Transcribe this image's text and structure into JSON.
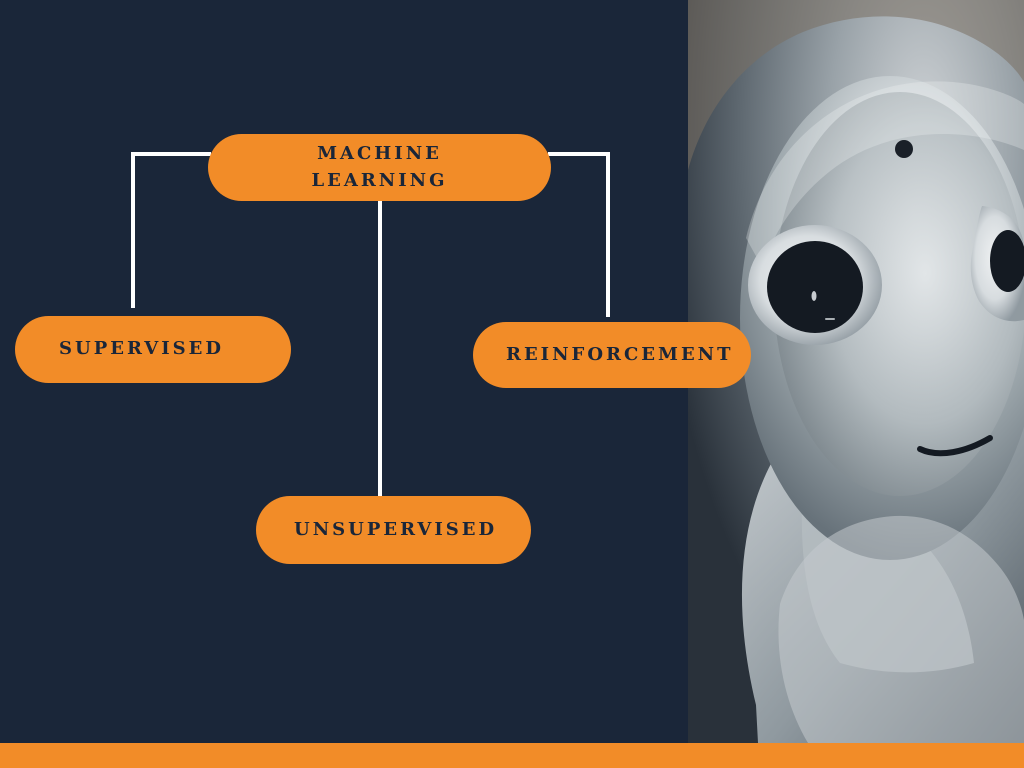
{
  "diagram": {
    "root": {
      "line1": "MACHINE",
      "line2": "LEARNING"
    },
    "children": {
      "supervised": "SUPERVISED",
      "reinforcement": "REINFORCEMENT",
      "unsupervised": "UNSUPERVISED"
    }
  },
  "colors": {
    "background": "#1a2639",
    "accent": "#f28c28",
    "connector": "#ffffff",
    "robot_highlight": "#d8dde0",
    "robot_shadow": "#2b333b",
    "eye_dark": "#141a22"
  },
  "illustration": {
    "subject": "robot-face"
  }
}
